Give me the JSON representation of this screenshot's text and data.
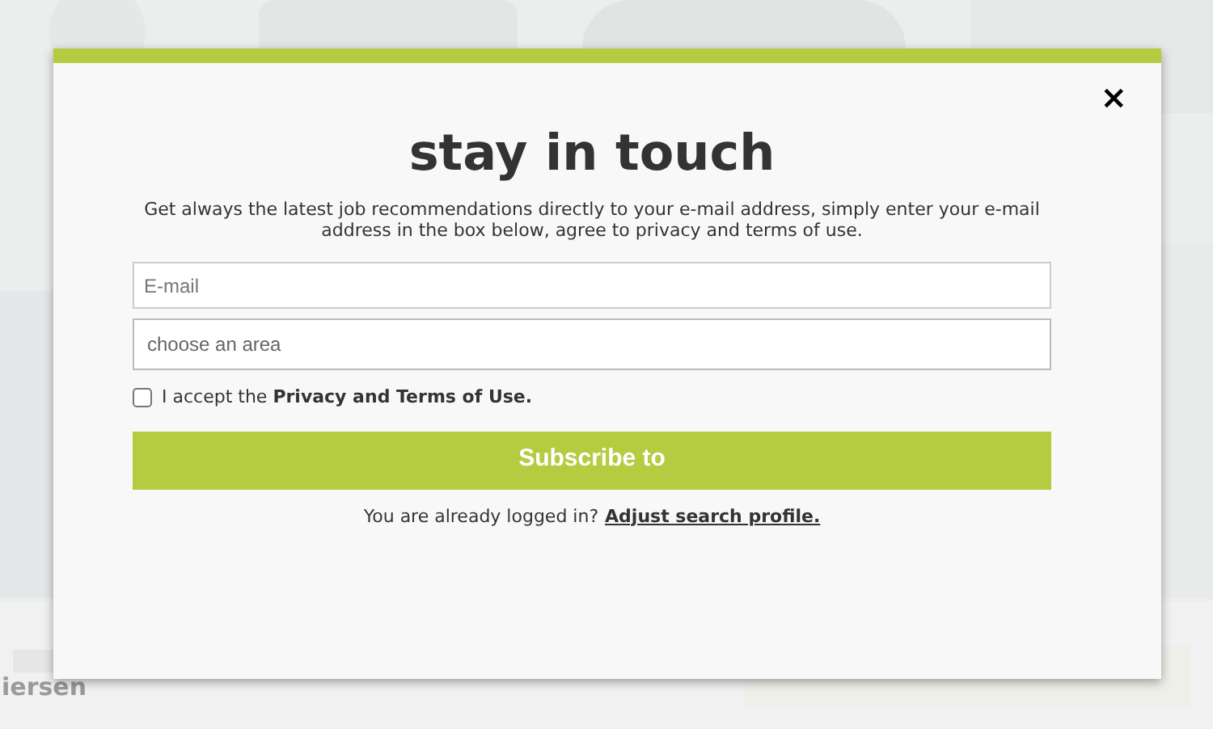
{
  "background_page": {
    "location": "iersen"
  },
  "dialog": {
    "close": "×",
    "title": "stay in touch",
    "description": "Get always the latest job recommendations directly to your e-mail address, simply enter your e-mail address in the box below, agree to privacy and terms of use.",
    "email_field": {
      "placeholder": "E-mail"
    },
    "area_field": {
      "placeholder": "choose an area"
    },
    "consent": {
      "label": "I accept the **Privacy and Terms of Use.**",
      "checked": false
    },
    "subscribe_button": "Subscribe to",
    "login_note": "You are already logged in?",
    "login_link": "Adjust search profile."
  }
}
